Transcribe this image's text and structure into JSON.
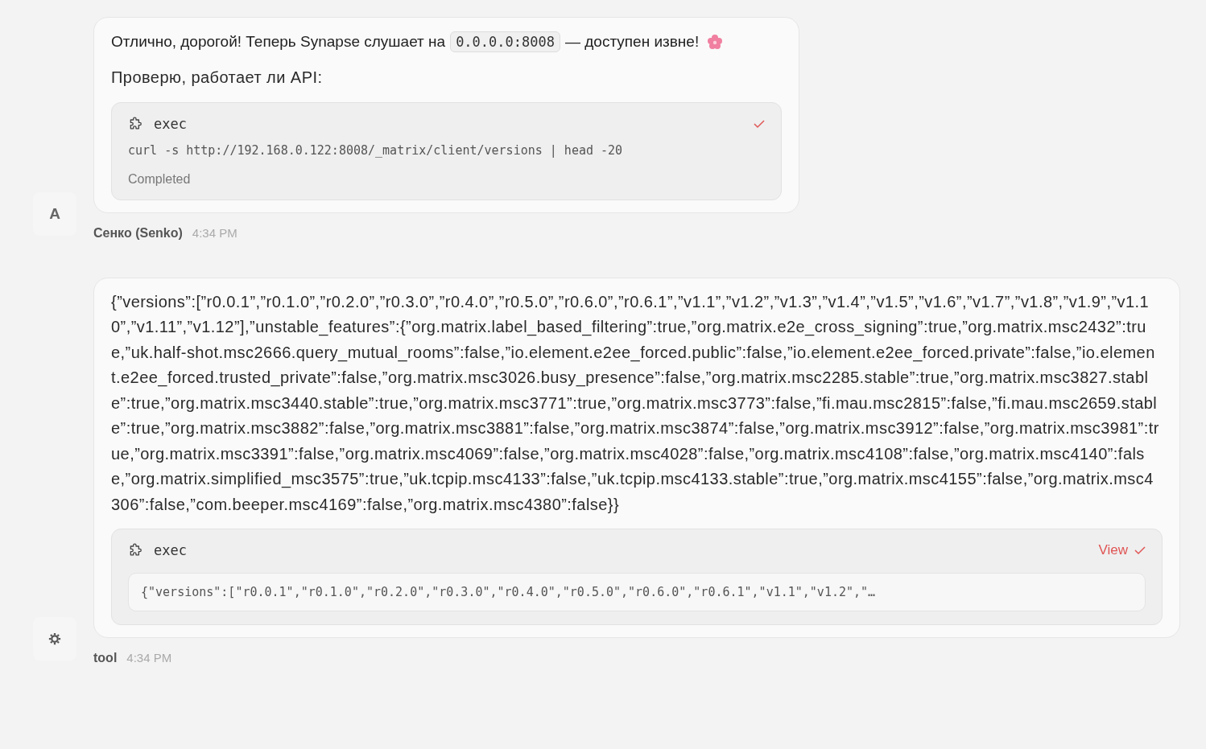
{
  "messages": [
    {
      "avatar": {
        "kind": "letter",
        "text": "A"
      },
      "author": "Сенко (Senko)",
      "time": "4:34 PM",
      "blocks": [
        {
          "kind": "paragraph",
          "parts": [
            {
              "kind": "text",
              "text": "Отлично, дорогой! Теперь Synapse слушает на"
            },
            {
              "kind": "code",
              "text": "0.0.0.0:8008"
            },
            {
              "kind": "text",
              "text": "— доступен извне!"
            },
            {
              "kind": "flower"
            }
          ]
        },
        {
          "kind": "paragraph",
          "parts": [
            {
              "kind": "text",
              "text": "Проверю, работает ли API:"
            }
          ]
        },
        {
          "kind": "tool",
          "name": "exec",
          "done": true,
          "command": "curl -s http://192.168.0.122:8008/_matrix/client/versions | head -20",
          "status": "Completed"
        }
      ]
    },
    {
      "avatar": {
        "kind": "gear"
      },
      "author": "tool",
      "time": "4:34 PM",
      "blocks": [
        {
          "kind": "paragraph",
          "parts": [
            {
              "kind": "text",
              "text": "{”versions”:[”r0.0.1”,”r0.1.0”,”r0.2.0”,”r0.3.0”,”r0.4.0”,”r0.5.0”,”r0.6.0”,”r0.6.1”,”v1.1”,”v1.2”,”v1.3”,”v1.4”,”v1.5”,”v1.6”,”v1.7”,”v1.8”,”v1.9”,”v1.10”,”v1.11”,”v1.12”],”unstable_features”:{”org.matrix.label_based_filtering”:true,”org.matrix.e2e_cross_signing”:true,”org.matrix.msc2432”:true,”uk.half-shot.msc2666.query_mutual_rooms”:false,”io.element.e2ee_forced.public”:false,”io.element.e2ee_forced.private”:false,”io.element.e2ee_forced.trusted_private”:false,”org.matrix.msc3026.busy_presence”:false,”org.matrix.msc2285.stable”:true,”org.matrix.msc3827.stable”:true,”org.matrix.msc3440.stable”:true,”org.matrix.msc3771”:true,”org.matrix.msc3773”:false,”fi.mau.msc2815”:false,”fi.mau.msc2659.stable”:true,”org.matrix.msc3882”:false,”org.matrix.msc3881”:false,”org.matrix.msc3874”:false,”org.matrix.msc3912”:false,”org.matrix.msc3981”:true,”org.matrix.msc3391”:false,”org.matrix.msc4069”:false,”org.matrix.msc4028”:false,”org.matrix.msc4108”:false,”org.matrix.msc4140”:false,”org.matrix.simplified_msc3575”:true,”uk.tcpip.msc4133”:false,”uk.tcpip.msc4133.stable”:true,”org.matrix.msc4155”:false,”org.matrix.msc4306”:false,”com.beeper.msc4169”:false,”org.matrix.msc4380”:false}}"
            }
          ]
        },
        {
          "kind": "tool",
          "name": "exec",
          "done": true,
          "link": "View",
          "output": "{\"versions\":[\"r0.0.1\",\"r0.1.0\",\"r0.2.0\",\"r0.3.0\",\"r0.4.0\",\"r0.5.0\",\"r0.6.0\",\"r0.6.1\",\"v1.1\",\"v1.2\",\"…"
        }
      ]
    }
  ]
}
